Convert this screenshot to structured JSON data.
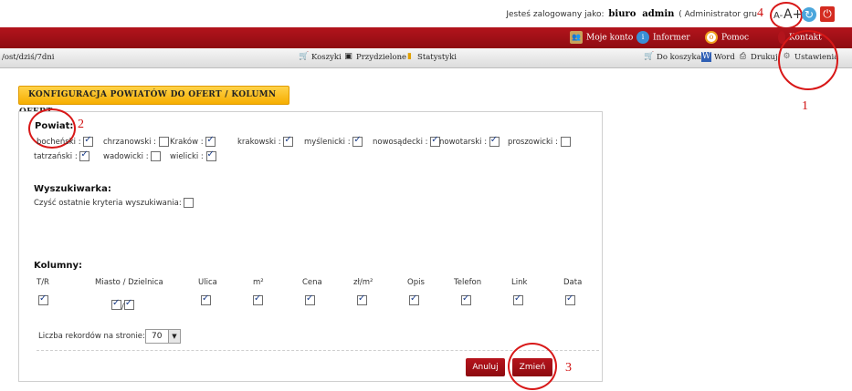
{
  "header": {
    "logged_as_label": "Jesteś zalogowany jako:",
    "user_name": "biuro",
    "user_login": "admin",
    "user_group": "( Administrator gru",
    "font_smaller": "A-",
    "font_larger": "A+"
  },
  "annotations": {
    "n1": "1",
    "n2": "2",
    "n3": "3",
    "n4": "4"
  },
  "menu": {
    "account": "Moje konto",
    "informer": "Informer",
    "help": "Pomoc",
    "contact": "Kontakt"
  },
  "toolbar": {
    "path": "/ost/dziś/7dni",
    "baskets": "Koszyki",
    "assigned": "Przydzielone",
    "stats": "Statystyki",
    "to_basket": "Do koszyka",
    "word": "Word",
    "print": "Drukuj",
    "settings": "Ustawienia"
  },
  "section": {
    "title": "Konfiguracja powiatów do ofert / kolumn ofert"
  },
  "powiat": {
    "label": "Powiat:",
    "items": [
      {
        "name": "bocheński :",
        "checked": true
      },
      {
        "name": "chrzanowski :",
        "checked": false
      },
      {
        "name": "Kraków :",
        "checked": true
      },
      {
        "name": "krakowski :",
        "checked": true
      },
      {
        "name": "myślenicki :",
        "checked": true
      },
      {
        "name": "nowosądecki :",
        "checked": true
      },
      {
        "name": "nowotarski :",
        "checked": true
      },
      {
        "name": "proszowicki :",
        "checked": false
      },
      {
        "name": "tatrzański :",
        "checked": true
      },
      {
        "name": "wadowicki :",
        "checked": false
      },
      {
        "name": "wielicki :",
        "checked": true
      }
    ]
  },
  "search": {
    "label": "Wyszukiwarka:",
    "clear_label": "Czyść ostatnie kryteria wyszukiwania:",
    "clear_checked": false
  },
  "columns": {
    "label": "Kolumny:",
    "items": [
      {
        "name": "T/R",
        "checked": true
      },
      {
        "name": "Miasto / Dzielnica",
        "checked": true
      },
      {
        "name": "Ulica",
        "checked": true
      },
      {
        "name": "m²",
        "checked": true
      },
      {
        "name": "Cena",
        "checked": true
      },
      {
        "name": "zł/m²",
        "checked": true
      },
      {
        "name": "Opis",
        "checked": true
      },
      {
        "name": "Telefon",
        "checked": true
      },
      {
        "name": "Link",
        "checked": true
      },
      {
        "name": "Data",
        "checked": true
      }
    ],
    "separator": "/"
  },
  "records": {
    "label": "Liczba rekordów na stronie:",
    "value": "70"
  },
  "buttons": {
    "cancel": "Anuluj",
    "change": "Zmień"
  }
}
